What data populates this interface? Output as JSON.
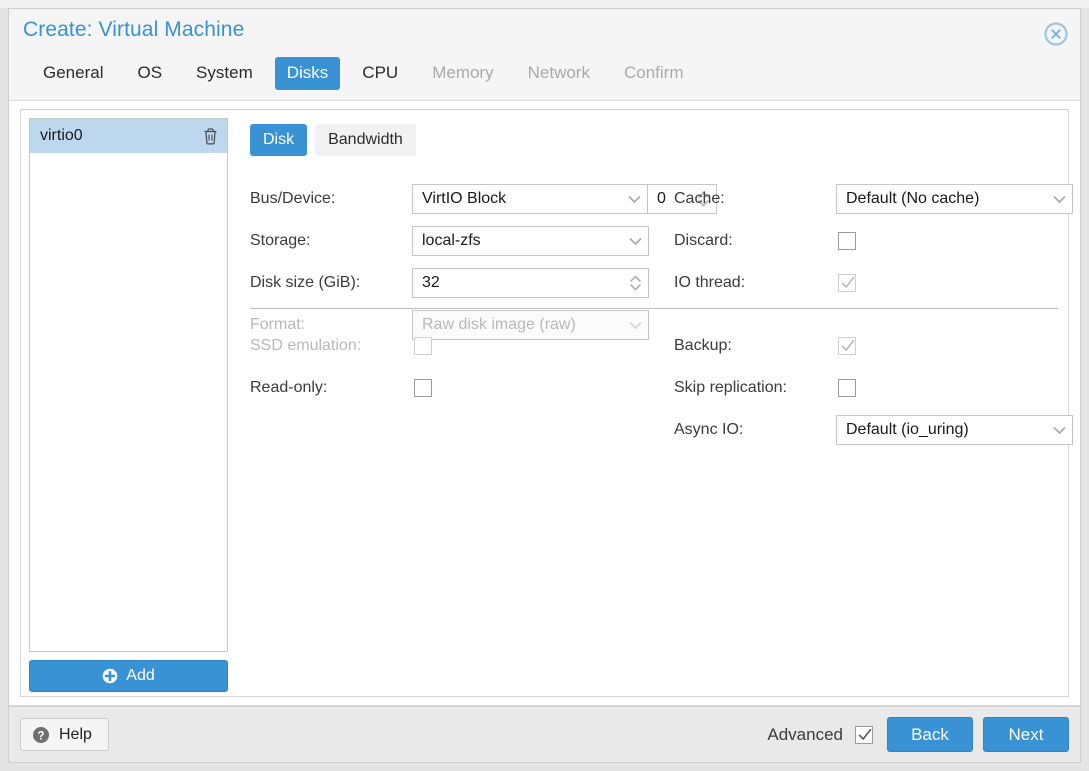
{
  "window": {
    "title": "Create: Virtual Machine",
    "close_icon": "close-circle-icon"
  },
  "wizard_tabs": [
    {
      "label": "General",
      "state": "enabled"
    },
    {
      "label": "OS",
      "state": "enabled"
    },
    {
      "label": "System",
      "state": "enabled"
    },
    {
      "label": "Disks",
      "state": "active"
    },
    {
      "label": "CPU",
      "state": "enabled"
    },
    {
      "label": "Memory",
      "state": "disabled"
    },
    {
      "label": "Network",
      "state": "disabled"
    },
    {
      "label": "Confirm",
      "state": "disabled"
    }
  ],
  "device_list": {
    "items": [
      {
        "label": "virtio0",
        "selected": true,
        "delete_icon": "trash-icon"
      }
    ],
    "add_button": {
      "label": "Add",
      "icon": "plus-circle-icon"
    }
  },
  "sub_tabs": [
    {
      "label": "Disk",
      "state": "active"
    },
    {
      "label": "Bandwidth",
      "state": "enabled"
    }
  ],
  "form": {
    "bus_device": {
      "label": "Bus/Device:",
      "bus_value": "VirtIO Block",
      "device_value": "0"
    },
    "storage": {
      "label": "Storage:",
      "value": "local-zfs"
    },
    "disk_size": {
      "label": "Disk size (GiB):",
      "value": "32"
    },
    "format": {
      "label": "Format:",
      "value": "Raw disk image (raw)",
      "disabled": true
    },
    "cache": {
      "label": "Cache:",
      "value": "Default (No cache)"
    },
    "discard": {
      "label": "Discard:",
      "checked": false
    },
    "io_thread": {
      "label": "IO thread:",
      "checked": true,
      "disabled": true
    },
    "ssd_emulation": {
      "label": "SSD emulation:",
      "checked": false,
      "disabled": true
    },
    "read_only": {
      "label": "Read-only:",
      "checked": false
    },
    "backup": {
      "label": "Backup:",
      "checked": true,
      "disabled": true
    },
    "skip_replication": {
      "label": "Skip replication:",
      "checked": false
    },
    "async_io": {
      "label": "Async IO:",
      "value": "Default (io_uring)"
    }
  },
  "footer": {
    "help_label": "Help",
    "help_icon": "question-circle-icon",
    "advanced_label": "Advanced",
    "advanced_checked": true,
    "back_label": "Back",
    "next_label": "Next"
  },
  "colors": {
    "accent": "#3892d4",
    "selection": "#bdd8ee",
    "title_text": "#3892d4",
    "disabled_text": "#b9b9b9"
  }
}
